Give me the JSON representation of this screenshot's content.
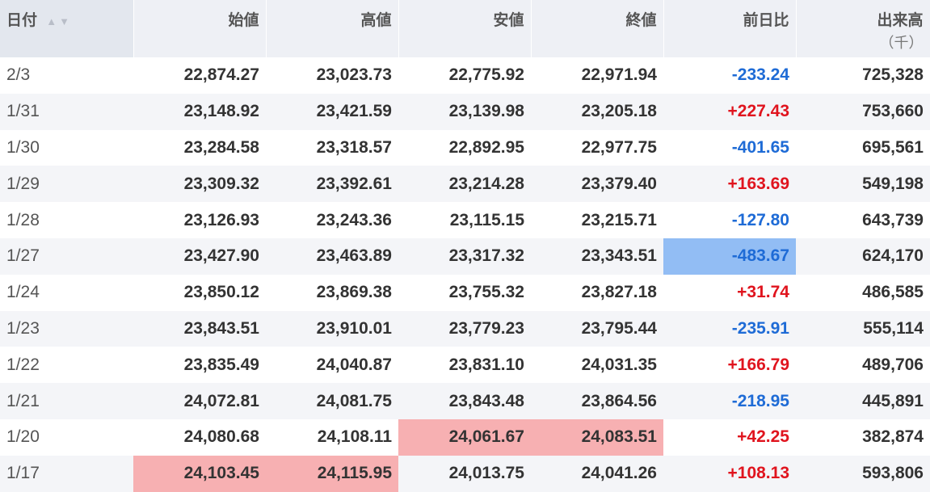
{
  "headers": {
    "date": "日付",
    "open": "始値",
    "high": "高値",
    "low": "安値",
    "close": "終値",
    "change": "前日比",
    "volume": "出来高",
    "volume_unit": "（千）"
  },
  "sort_icons": {
    "asc": "▲",
    "desc": "▼"
  },
  "colors": {
    "up": "#e0141e",
    "down": "#1e6bd6",
    "highlight_high": "#f7b0b2",
    "highlight_low": "#92bdf4"
  },
  "rows": [
    {
      "date": "2/3",
      "open": "22,874.27",
      "high": "23,023.73",
      "low": "22,775.92",
      "close": "22,971.94",
      "change": "-233.24",
      "volume": "725,328"
    },
    {
      "date": "1/31",
      "open": "23,148.92",
      "high": "23,421.59",
      "low": "23,139.98",
      "close": "23,205.18",
      "change": "+227.43",
      "volume": "753,660"
    },
    {
      "date": "1/30",
      "open": "23,284.58",
      "high": "23,318.57",
      "low": "22,892.95",
      "close": "22,977.75",
      "change": "-401.65",
      "volume": "695,561"
    },
    {
      "date": "1/29",
      "open": "23,309.32",
      "high": "23,392.61",
      "low": "23,214.28",
      "close": "23,379.40",
      "change": "+163.69",
      "volume": "549,198"
    },
    {
      "date": "1/28",
      "open": "23,126.93",
      "high": "23,243.36",
      "low": "23,115.15",
      "close": "23,215.71",
      "change": "-127.80",
      "volume": "643,739"
    },
    {
      "date": "1/27",
      "open": "23,427.90",
      "high": "23,463.89",
      "low": "23,317.32",
      "close": "23,343.51",
      "change": "-483.67",
      "volume": "624,170"
    },
    {
      "date": "1/24",
      "open": "23,850.12",
      "high": "23,869.38",
      "low": "23,755.32",
      "close": "23,827.18",
      "change": "+31.74",
      "volume": "486,585"
    },
    {
      "date": "1/23",
      "open": "23,843.51",
      "high": "23,910.01",
      "low": "23,779.23",
      "close": "23,795.44",
      "change": "-235.91",
      "volume": "555,114"
    },
    {
      "date": "1/22",
      "open": "23,835.49",
      "high": "24,040.87",
      "low": "23,831.10",
      "close": "24,031.35",
      "change": "+166.79",
      "volume": "489,706"
    },
    {
      "date": "1/21",
      "open": "24,072.81",
      "high": "24,081.75",
      "low": "23,843.48",
      "close": "23,864.56",
      "change": "-218.95",
      "volume": "445,891"
    },
    {
      "date": "1/20",
      "open": "24,080.68",
      "high": "24,108.11",
      "low": "24,061.67",
      "close": "24,083.51",
      "change": "+42.25",
      "volume": "382,874"
    },
    {
      "date": "1/17",
      "open": "24,103.45",
      "high": "24,115.95",
      "low": "24,013.75",
      "close": "24,041.26",
      "change": "+108.13",
      "volume": "593,806"
    }
  ]
}
